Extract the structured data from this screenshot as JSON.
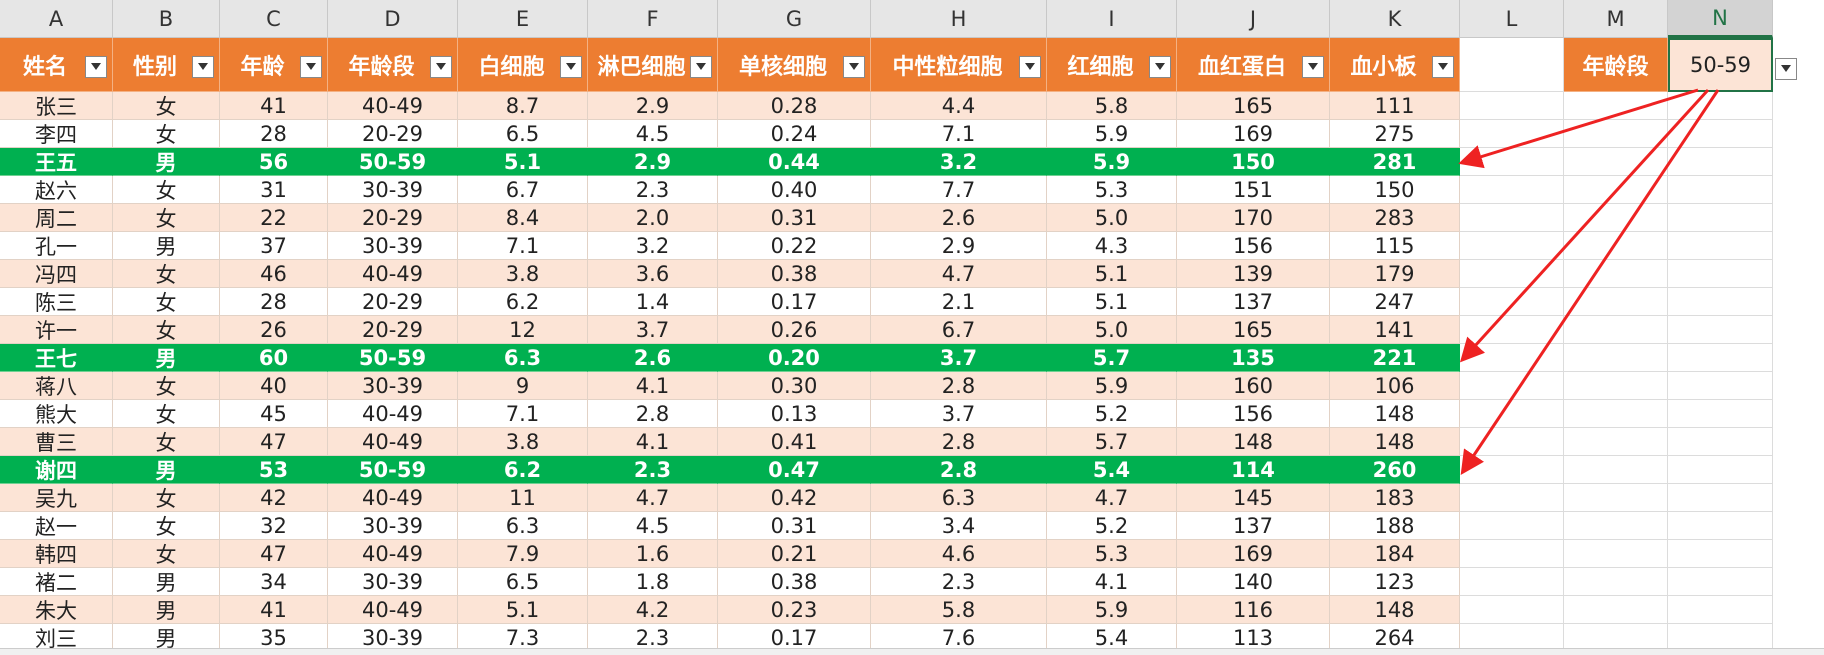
{
  "columns": [
    "A",
    "B",
    "C",
    "D",
    "E",
    "F",
    "G",
    "H",
    "I",
    "J",
    "K",
    "L",
    "M",
    "N"
  ],
  "selected_column": "N",
  "headers": [
    "姓名",
    "性别",
    "年龄",
    "年龄段",
    "白细胞",
    "淋巴细胞",
    "单核细胞",
    "中性粒细胞",
    "红细胞",
    "血红蛋白",
    "血小板"
  ],
  "rows": [
    [
      "张三",
      "女",
      "41",
      "40-49",
      "8.7",
      "2.9",
      "0.28",
      "4.4",
      "5.8",
      "165",
      "111"
    ],
    [
      "李四",
      "女",
      "28",
      "20-29",
      "6.5",
      "4.5",
      "0.24",
      "7.1",
      "5.9",
      "169",
      "275"
    ],
    [
      "王五",
      "男",
      "56",
      "50-59",
      "5.1",
      "2.9",
      "0.44",
      "3.2",
      "5.9",
      "150",
      "281"
    ],
    [
      "赵六",
      "女",
      "31",
      "30-39",
      "6.7",
      "2.3",
      "0.40",
      "7.7",
      "5.3",
      "151",
      "150"
    ],
    [
      "周二",
      "女",
      "22",
      "20-29",
      "8.4",
      "2.0",
      "0.31",
      "2.6",
      "5.0",
      "170",
      "283"
    ],
    [
      "孔一",
      "男",
      "37",
      "30-39",
      "7.1",
      "3.2",
      "0.22",
      "2.9",
      "4.3",
      "156",
      "115"
    ],
    [
      "冯四",
      "女",
      "46",
      "40-49",
      "3.8",
      "3.6",
      "0.38",
      "4.7",
      "5.1",
      "139",
      "179"
    ],
    [
      "陈三",
      "女",
      "28",
      "20-29",
      "6.2",
      "1.4",
      "0.17",
      "2.1",
      "5.1",
      "137",
      "247"
    ],
    [
      "许一",
      "女",
      "26",
      "20-29",
      "12",
      "3.7",
      "0.26",
      "6.7",
      "5.0",
      "165",
      "141"
    ],
    [
      "王七",
      "男",
      "60",
      "50-59",
      "6.3",
      "2.6",
      "0.20",
      "3.7",
      "5.7",
      "135",
      "221"
    ],
    [
      "蒋八",
      "女",
      "40",
      "30-39",
      "9",
      "4.1",
      "0.30",
      "2.8",
      "5.9",
      "160",
      "106"
    ],
    [
      "熊大",
      "女",
      "45",
      "40-49",
      "7.1",
      "2.8",
      "0.13",
      "3.7",
      "5.2",
      "156",
      "148"
    ],
    [
      "曹三",
      "女",
      "47",
      "40-49",
      "3.8",
      "4.1",
      "0.41",
      "2.8",
      "5.7",
      "148",
      "148"
    ],
    [
      "谢四",
      "男",
      "53",
      "50-59",
      "6.2",
      "2.3",
      "0.47",
      "2.8",
      "5.4",
      "114",
      "260"
    ],
    [
      "吴九",
      "女",
      "42",
      "40-49",
      "11",
      "4.7",
      "0.42",
      "6.3",
      "4.7",
      "145",
      "183"
    ],
    [
      "赵一",
      "女",
      "32",
      "30-39",
      "6.3",
      "4.5",
      "0.31",
      "3.4",
      "5.2",
      "137",
      "188"
    ],
    [
      "韩四",
      "女",
      "47",
      "40-49",
      "7.9",
      "1.6",
      "0.21",
      "4.6",
      "5.3",
      "169",
      "184"
    ],
    [
      "褚二",
      "男",
      "34",
      "30-39",
      "6.5",
      "1.8",
      "0.38",
      "2.3",
      "4.1",
      "140",
      "123"
    ],
    [
      "朱大",
      "男",
      "41",
      "40-49",
      "5.1",
      "4.2",
      "0.23",
      "5.8",
      "5.9",
      "116",
      "148"
    ],
    [
      "刘三",
      "男",
      "35",
      "30-39",
      "7.3",
      "2.3",
      "0.17",
      "7.6",
      "5.4",
      "113",
      "264"
    ]
  ],
  "highlight_rows": [
    2,
    9,
    13
  ],
  "side_label": "年龄段",
  "side_value": "50-59",
  "icons": {
    "filter": "filter-dropdown-icon",
    "dropdown": "chevron-down-icon"
  },
  "colors": {
    "header_bg": "#ed7d31",
    "band_odd": "#fce4d6",
    "highlight": "#00b050",
    "arrow": "#ee2222"
  }
}
